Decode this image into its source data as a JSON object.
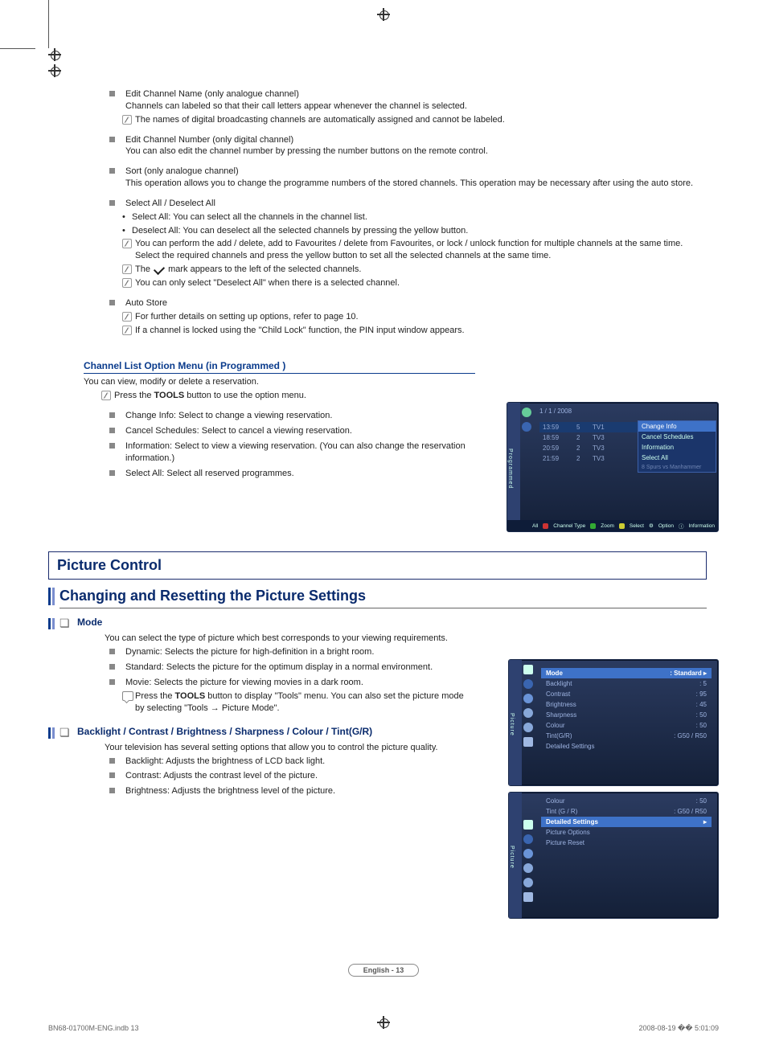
{
  "margins": {},
  "sections": {
    "editChannelName": {
      "title": "Edit Channel Name (only analogue channel)",
      "desc": "Channels can labeled so that their call letters appear whenever the channel is selected.",
      "note": "The names of digital broadcasting channels are automatically assigned and cannot be labeled."
    },
    "editChannelNumber": {
      "title": "Edit Channel Number (only digital channel)",
      "desc": "You can also edit the channel number by pressing the number buttons on the remote control."
    },
    "sort": {
      "title": "Sort (only analogue channel)",
      "desc": "This operation allows you to change the programme numbers of the stored channels. This operation may be necessary after using the auto store."
    },
    "selectAll": {
      "title": "Select All / Deselect All",
      "sub1": "Select All: You can select all the channels in the channel list.",
      "sub2": "Deselect All: You can deselect all the selected channels by pressing the yellow button.",
      "note1": "You can perform the add / delete, add to Favourites / delete from Favourites, or lock / unlock function for multiple channels at the same time. Select the required channels and press the yellow button to set all the selected channels at the same time.",
      "note2_a": "The ",
      "note2_b": " mark appears to the left of the selected channels.",
      "note3": "You can only select \"Deselect All\" when there is a selected channel."
    },
    "autoStore": {
      "title": "Auto Store",
      "note1": "For further details on setting up options, refer to page 10.",
      "note2": "If a channel is locked using the \"Child Lock\" function, the PIN input window appears."
    }
  },
  "clom": {
    "title": "Channel List Option Menu (in Programmed )",
    "desc": "You can view, modify or delete a reservation.",
    "press_a": "Press the ",
    "press_b": "TOOLS",
    "press_c": " button to use the option menu.",
    "items": {
      "changeInfo": "Change Info: Select to change a viewing reservation.",
      "cancel": "Cancel Schedules: Select to cancel a viewing reservation.",
      "info": "Information: Select to view a viewing reservation. (You can also change the reservation information.)",
      "selAll": "Select All: Select all reserved programmes."
    }
  },
  "pictureControl": "Picture Control",
  "changingTitle": "Changing and Resetting the Picture Settings",
  "mode": {
    "label": "Mode",
    "desc": "You can select the type of picture which best corresponds to your viewing requirements.",
    "dynamic": "Dynamic: Selects the picture for high-definition in a bright room.",
    "standard": "Standard: Selects the picture for the optimum display in a normal environment.",
    "movie": "Movie: Selects the picture for viewing movies in a dark room.",
    "tip_a": "Press the ",
    "tip_b": "TOOLS",
    "tip_c": " button to display \"Tools\" menu. You can also set the picture mode by selecting \"Tools → Picture Mode\"."
  },
  "bcbs": {
    "label": "Backlight / Contrast / Brightness / Sharpness / Colour / Tint(G/R)",
    "desc": "Your television has several setting options that allow you to control the picture quality.",
    "backlight": "Backlight: Adjusts the brightness of LCD back light.",
    "contrast": "Contrast: Adjusts the contrast level of the picture.",
    "brightness": "Brightness: Adjusts the brightness level of the picture."
  },
  "osd1": {
    "tab": "Programmed",
    "date": "1 / 1 / 2008",
    "rows": [
      {
        "t": "13:59",
        "n": "5",
        "c": "TV1"
      },
      {
        "t": "18:59",
        "n": "2",
        "c": "TV3"
      },
      {
        "t": "20:59",
        "n": "2",
        "c": "TV3"
      },
      {
        "t": "21:59",
        "n": "2",
        "c": "TV3"
      }
    ],
    "popup": {
      "i1": "Change Info",
      "i2": "Cancel Schedules",
      "i3": "Information",
      "i4": "Select All",
      "dim": "8 Spurs vs Manhammer"
    },
    "footer": {
      "all": "All",
      "ct": "Channel Type",
      "zoom": "Zoom",
      "sel": "Select",
      "opt": "Option",
      "info": "Information"
    }
  },
  "osd2": {
    "tab": "Picture",
    "rows": [
      {
        "k": "Mode",
        "v": ": Standard",
        "head": true
      },
      {
        "k": "Backlight",
        "v": ": 5"
      },
      {
        "k": "Contrast",
        "v": ": 95"
      },
      {
        "k": "Brightness",
        "v": ": 45"
      },
      {
        "k": "Sharpness",
        "v": ": 50"
      },
      {
        "k": "Colour",
        "v": ": 50"
      },
      {
        "k": "Tint(G/R)",
        "v": ": G50 / R50"
      },
      {
        "k": "Detailed Settings",
        "v": ""
      }
    ]
  },
  "osd3": {
    "tab": "Picture",
    "rows": [
      {
        "k": "Colour",
        "v": ": 50"
      },
      {
        "k": "Tint (G / R)",
        "v": ": G50 / R50"
      },
      {
        "k": "Detailed Settings",
        "v": "",
        "head": true
      },
      {
        "k": "Picture Options",
        "v": ""
      },
      {
        "k": "Picture Reset",
        "v": ""
      }
    ]
  },
  "pageFoot": "English - 13",
  "docfoot": {
    "left": "BN68-01700M-ENG.indb   13",
    "right": "2008-08-19   �� 5:01:09"
  }
}
